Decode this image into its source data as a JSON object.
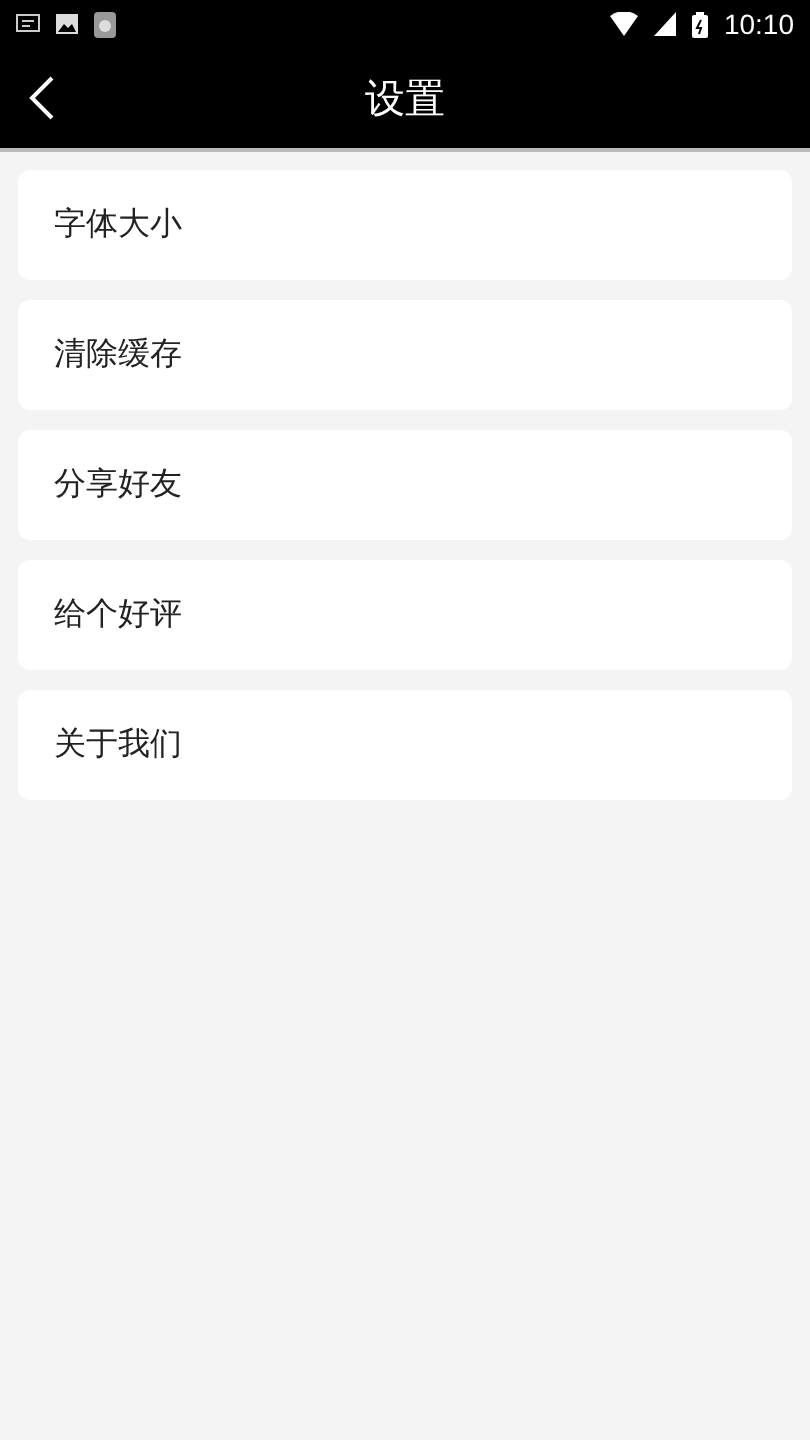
{
  "status_bar": {
    "time": "10:10"
  },
  "header": {
    "title": "设置"
  },
  "items": [
    {
      "label": "字体大小"
    },
    {
      "label": "清除缓存"
    },
    {
      "label": "分享好友"
    },
    {
      "label": "给个好评"
    },
    {
      "label": "关于我们"
    }
  ]
}
